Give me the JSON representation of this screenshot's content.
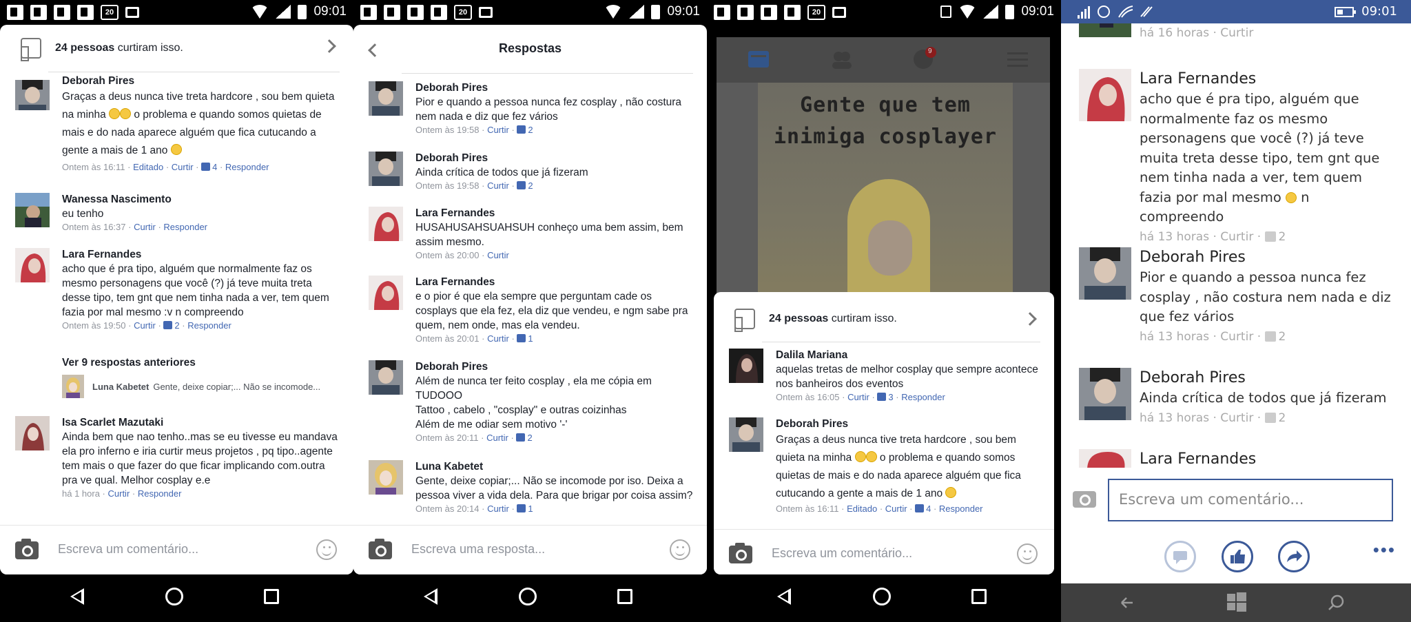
{
  "status": {
    "time": "09:01",
    "notif_count": "20"
  },
  "colors": {
    "fb_blue": "#4267b2",
    "wp_blue": "#3b5998",
    "meta_grey": "#90949c"
  },
  "panel1": {
    "likes_count": "24 pessoas",
    "likes_suffix": " curtiram isso.",
    "comments": [
      {
        "name": "Deborah Pires",
        "text": "Graças a deus nunca tive treta hardcore , sou bem quieta na minha",
        "text2": " o problema e quando somos quietas de mais e do nada aparece alguém que fica cutucando a gente a mais de 1 ano",
        "time": "Ontem às 16:11",
        "edited": "Editado",
        "like": "Curtir",
        "count": "4",
        "reply": "Responder"
      },
      {
        "name": "Wanessa Nascimento",
        "text": "eu tenho",
        "time": "Ontem às 16:37",
        "like": "Curtir",
        "reply": "Responder"
      },
      {
        "name": "Lara Fernandes",
        "text": "acho que é pra tipo, alguém que normalmente faz os mesmo personagens que você (?) já teve muita treta desse tipo, tem gnt que nem tinha nada a ver, tem quem fazia por mal mesmo :v n compreendo",
        "time": "Ontem às 19:50",
        "like": "Curtir",
        "count": "2",
        "reply": "Responder"
      },
      {
        "name": "Isa Scarlet Mazutaki",
        "text": "Ainda bem que nao tenho..mas se eu tivesse eu mandava ela pro inferno e iria curtir meus projetos , pq tipo..agente tem mais o que fazer do que ficar implicando com.outra pra ve qual. Melhor cosplay e.e",
        "time": "há 1 hora",
        "like": "Curtir",
        "reply": "Responder"
      }
    ],
    "prev_replies": "Ver 9 respostas anteriores",
    "reply_preview_name": "Luna Kabetet",
    "reply_preview_text": "Gente, deixe copiar;... Não se incomode...",
    "compose_placeholder": "Escreva um comentário..."
  },
  "panel2": {
    "title": "Respostas",
    "replies": [
      {
        "name": "Deborah Pires",
        "text": "Pior e quando a pessoa nunca fez cosplay , não costura nem nada e diz que fez vários",
        "time": "Ontem às 19:58",
        "like": "Curtir",
        "count": "2"
      },
      {
        "name": "Deborah Pires",
        "text": "Ainda crítica de todos que já fizeram",
        "time": "Ontem às 19:58",
        "like": "Curtir",
        "count": "2"
      },
      {
        "name": "Lara Fernandes",
        "text": "HUSAHUSAHSUAHSUH conheço uma bem assim, bem assim mesmo.",
        "time": "Ontem às 20:00",
        "like": "Curtir",
        "count": ""
      },
      {
        "name": "Lara Fernandes",
        "text": "e o pior é que ela sempre que perguntam cade os cosplays que ela fez, ela diz que vendeu, e ngm sabe pra quem, nem onde, mas ela vendeu.",
        "time": "Ontem às 20:01",
        "like": "Curtir",
        "count": "1"
      },
      {
        "name": "Deborah Pires",
        "text": "Além de nunca ter feito cosplay , ela me cópia em TUDOOO",
        "text2": "Tattoo , cabelo , \"cosplay\" e outras coizinhas",
        "text3": "Além de me odiar sem motivo '-'",
        "time": "Ontem às 20:11",
        "like": "Curtir",
        "count": "2"
      },
      {
        "name": "Luna Kabetet",
        "text": "Gente, deixe copiar;... Não se incomode por iso. Deixa a pessoa viver a vida dela. Para que brigar por coisa assim?",
        "time": "Ontem às 20:14",
        "like": "Curtir",
        "count": "1"
      }
    ],
    "compose_placeholder": "Escreva uma resposta..."
  },
  "panel3": {
    "bg_title_line1": "Gente que tem",
    "bg_title_line2": "inimiga cosplayer",
    "notif_badge": "9",
    "likes_count": "24 pessoas",
    "likes_suffix": " curtiram isso.",
    "comments": [
      {
        "name": "Dalila Mariana",
        "text": "aquelas tretas de melhor cosplay que sempre acontece nos banheiros dos eventos",
        "time": "Ontem às 16:05",
        "like": "Curtir",
        "count": "3",
        "reply": "Responder"
      },
      {
        "name": "Deborah Pires",
        "text": "Graças a deus nunca tive treta hardcore , sou bem quieta na minha",
        "text2": " o problema e quando somos quietas de mais e do nada aparece alguém que fica cutucando a gente a mais de 1 ano",
        "time": "Ontem às 16:11",
        "edited": "Editado",
        "like": "Curtir",
        "count": "4",
        "reply": "Responder"
      }
    ],
    "compose_placeholder": "Escreva um comentário..."
  },
  "panel4": {
    "top_meta": "há 16 horas",
    "top_like": "Curtir",
    "comments": [
      {
        "name": "Lara Fernandes",
        "text": "acho que é pra tipo, alguém que normalmente faz os mesmo personagens que você (?) já teve muita treta desse tipo, tem gnt que nem tinha nada a ver, tem quem fazia por mal mesmo",
        "text2": " n compreendo",
        "time": "há 13 horas",
        "like": "Curtir",
        "count": "2"
      },
      {
        "name": "Deborah Pires",
        "text": "Pior e quando a pessoa nunca fez cosplay , não costura nem nada e diz que fez vários",
        "time": "há 13 horas",
        "like": "Curtir",
        "count": "2"
      },
      {
        "name": "Deborah Pires",
        "text": "Ainda crítica de todos que já fizeram",
        "time": "há 13 horas",
        "like": "Curtir",
        "count": "2"
      },
      {
        "name": "Lara Fernandes"
      }
    ],
    "compose_placeholder": "Escreva um comentário...",
    "more": "•••"
  }
}
